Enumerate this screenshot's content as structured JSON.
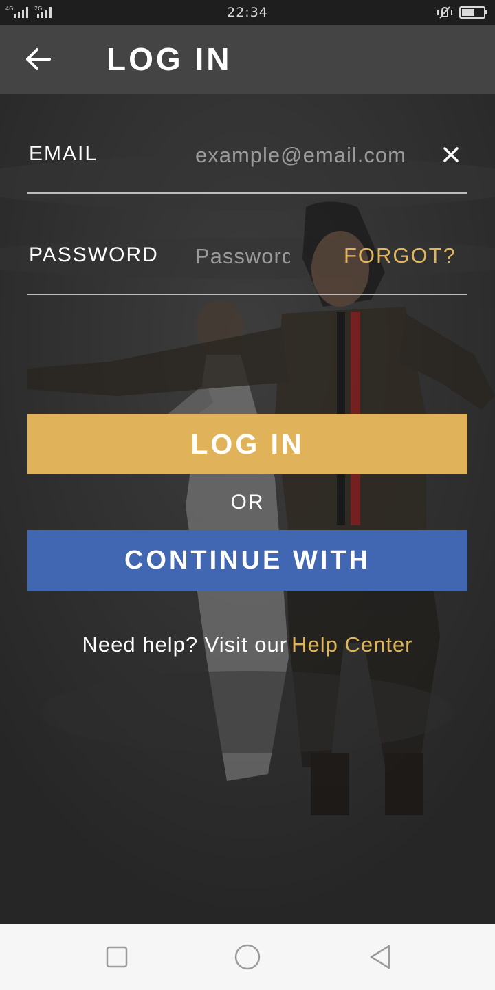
{
  "status_bar": {
    "network_1": "4G",
    "network_2": "2G",
    "time": "22:34",
    "icons": [
      "signal-icon",
      "vibrate-mute-icon",
      "battery-icon"
    ]
  },
  "app_bar": {
    "back_icon": "arrow-left-icon",
    "title": "LOG IN"
  },
  "form": {
    "email_label": "EMAIL",
    "email_placeholder": "example@email.com",
    "clear_icon": "close-icon",
    "password_label": "PASSWORD",
    "password_placeholder": "Password",
    "forgot_label": "FORGOT?"
  },
  "actions": {
    "login_label": "LOG IN",
    "or_label": "OR",
    "continue_label": "CONTINUE WITH"
  },
  "help": {
    "prefix": "Need help? Visit our",
    "link": "Help Center"
  },
  "nav_bar": {
    "icons": [
      "recent-apps-icon",
      "home-icon",
      "back-triangle-icon"
    ]
  },
  "colors": {
    "accent_gold": "#e0b35a",
    "facebook_blue": "#4267b2",
    "app_bar": "#444444",
    "background": "#2b2b2b"
  }
}
